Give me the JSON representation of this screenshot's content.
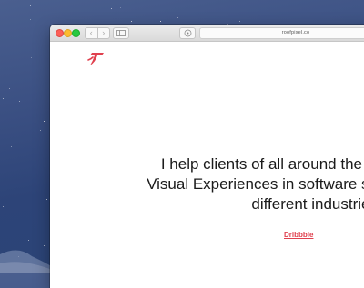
{
  "browser": {
    "url": "roofpixel.co"
  },
  "page": {
    "headline_lines": [
      "I help clients of all around the w",
      "Visual Experiences in software so",
      "different industries"
    ],
    "link_label": "Dribbble"
  },
  "colors": {
    "accent": "#e0404e",
    "desktop": "#3a4f82"
  }
}
